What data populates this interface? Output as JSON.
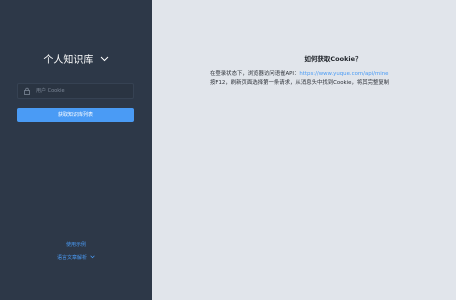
{
  "sidebar": {
    "title": "个人知识库",
    "cookie_input": {
      "placeholder": "用户 Cookie",
      "value": ""
    },
    "fetch_button_label": "获取知识库列表",
    "footer": {
      "guide_link": "使用示例",
      "example_link": "语言文章解析"
    }
  },
  "help": {
    "title": "如何获取Cookie？",
    "line1_prefix": "在登录状态下，浏览器访问语雀API：",
    "line1_link": "https://www.yuque.com/api/mine",
    "line2": "按F12，刷新页面选择第一条请求，从消息头中找到Cookie，将其完整复制"
  },
  "colors": {
    "sidebar_bg": "#2d3848",
    "main_bg": "#e1e5eb",
    "accent": "#4a9bf5"
  }
}
